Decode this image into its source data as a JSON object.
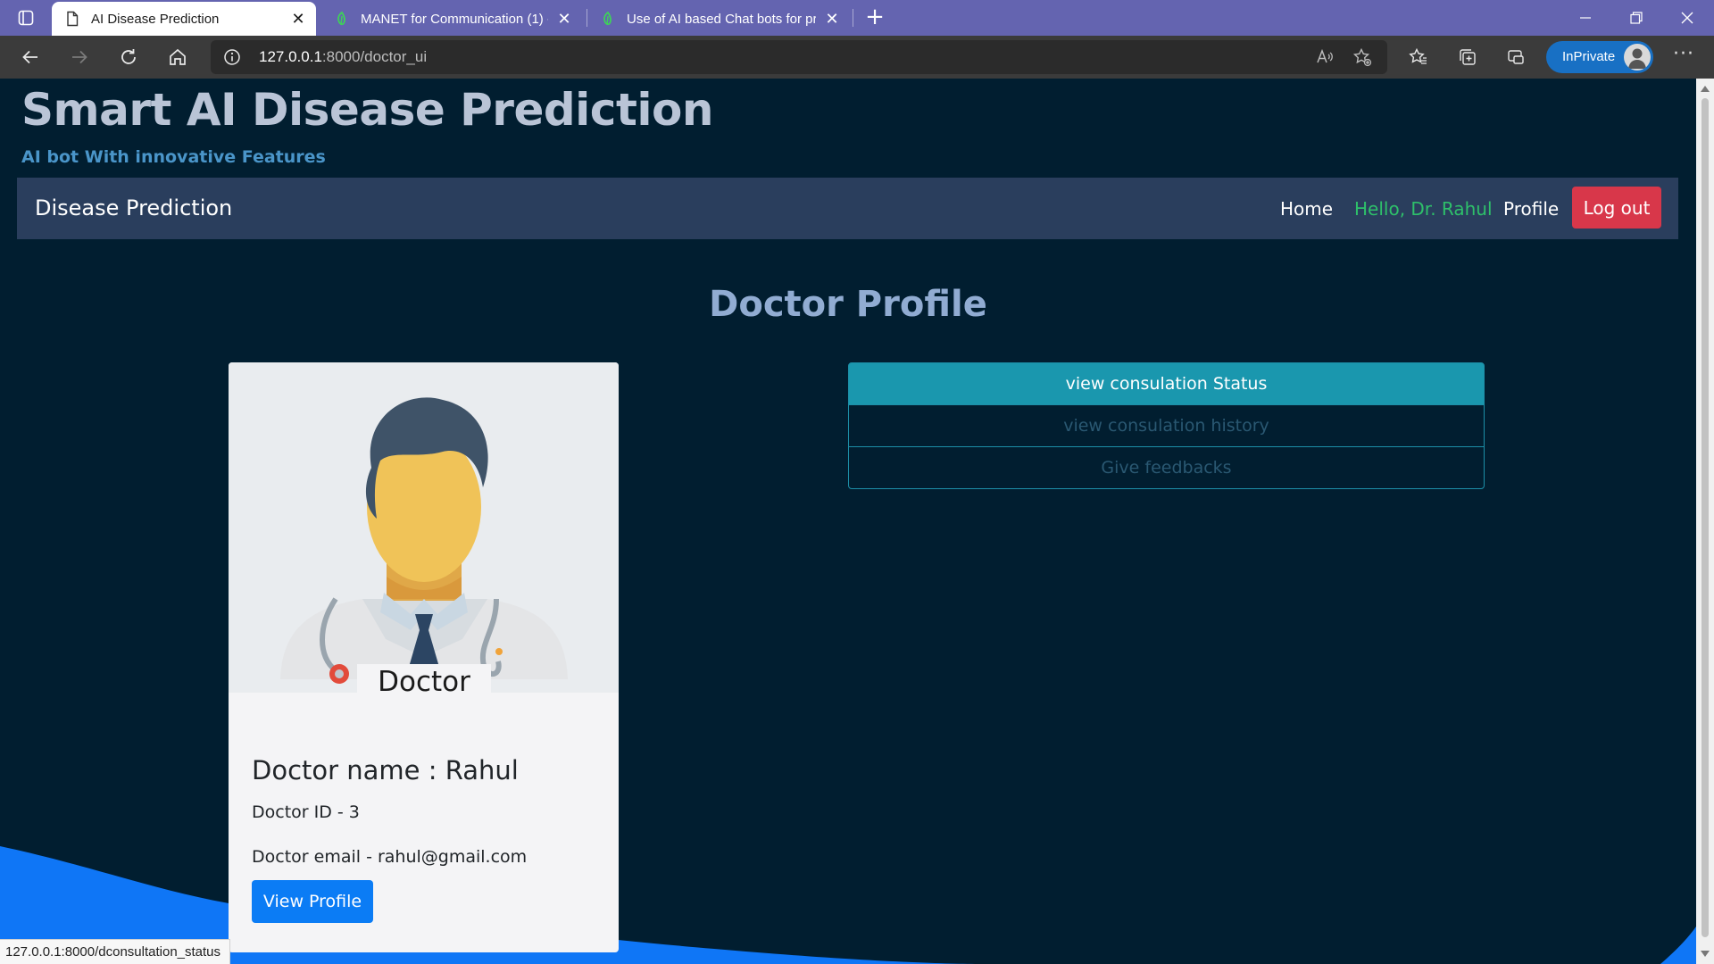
{
  "browser": {
    "tabs": [
      {
        "title": "AI Disease Prediction",
        "active": true,
        "icon": "page-icon"
      },
      {
        "title": "MANET for Communication (1) -",
        "active": false,
        "icon": "green-leaf-icon"
      },
      {
        "title": "Use of AI based Chat bots for pr",
        "active": false,
        "icon": "green-leaf-icon"
      }
    ],
    "url_host": "127.0.0.1",
    "url_rest": ":8000/doctor_ui",
    "inprivate_label": "InPrivate",
    "accent": "#6464b0"
  },
  "header": {
    "title": "Smart AI Disease Prediction",
    "subtitle": "AI bot With innovative Features"
  },
  "navbar": {
    "brand": "Disease Prediction",
    "home": "Home",
    "hello": "Hello, Dr. Rahul",
    "profile": "Profile",
    "logout": "Log out"
  },
  "main": {
    "heading": "Doctor Profile",
    "card": {
      "image_caption": "Doctor",
      "name": "Doctor name : Rahul",
      "id_line": "Doctor ID - 3",
      "email_line": "Doctor email - rahul@gmail.com",
      "button": "View Profile"
    },
    "menu": [
      {
        "label": "view consulation Status",
        "active": true
      },
      {
        "label": "view consulation history",
        "active": false
      },
      {
        "label": "Give feedbacks",
        "active": false
      }
    ]
  },
  "status_url": "127.0.0.1:8000/dconsultation_status",
  "colors": {
    "page_bg": "#011e30",
    "navbar_bg": "#2a3e5d",
    "logout": "#d8374a",
    "primary": "#0b7cf5",
    "info": "#1a97ae",
    "hello_green": "#2ec06a"
  }
}
